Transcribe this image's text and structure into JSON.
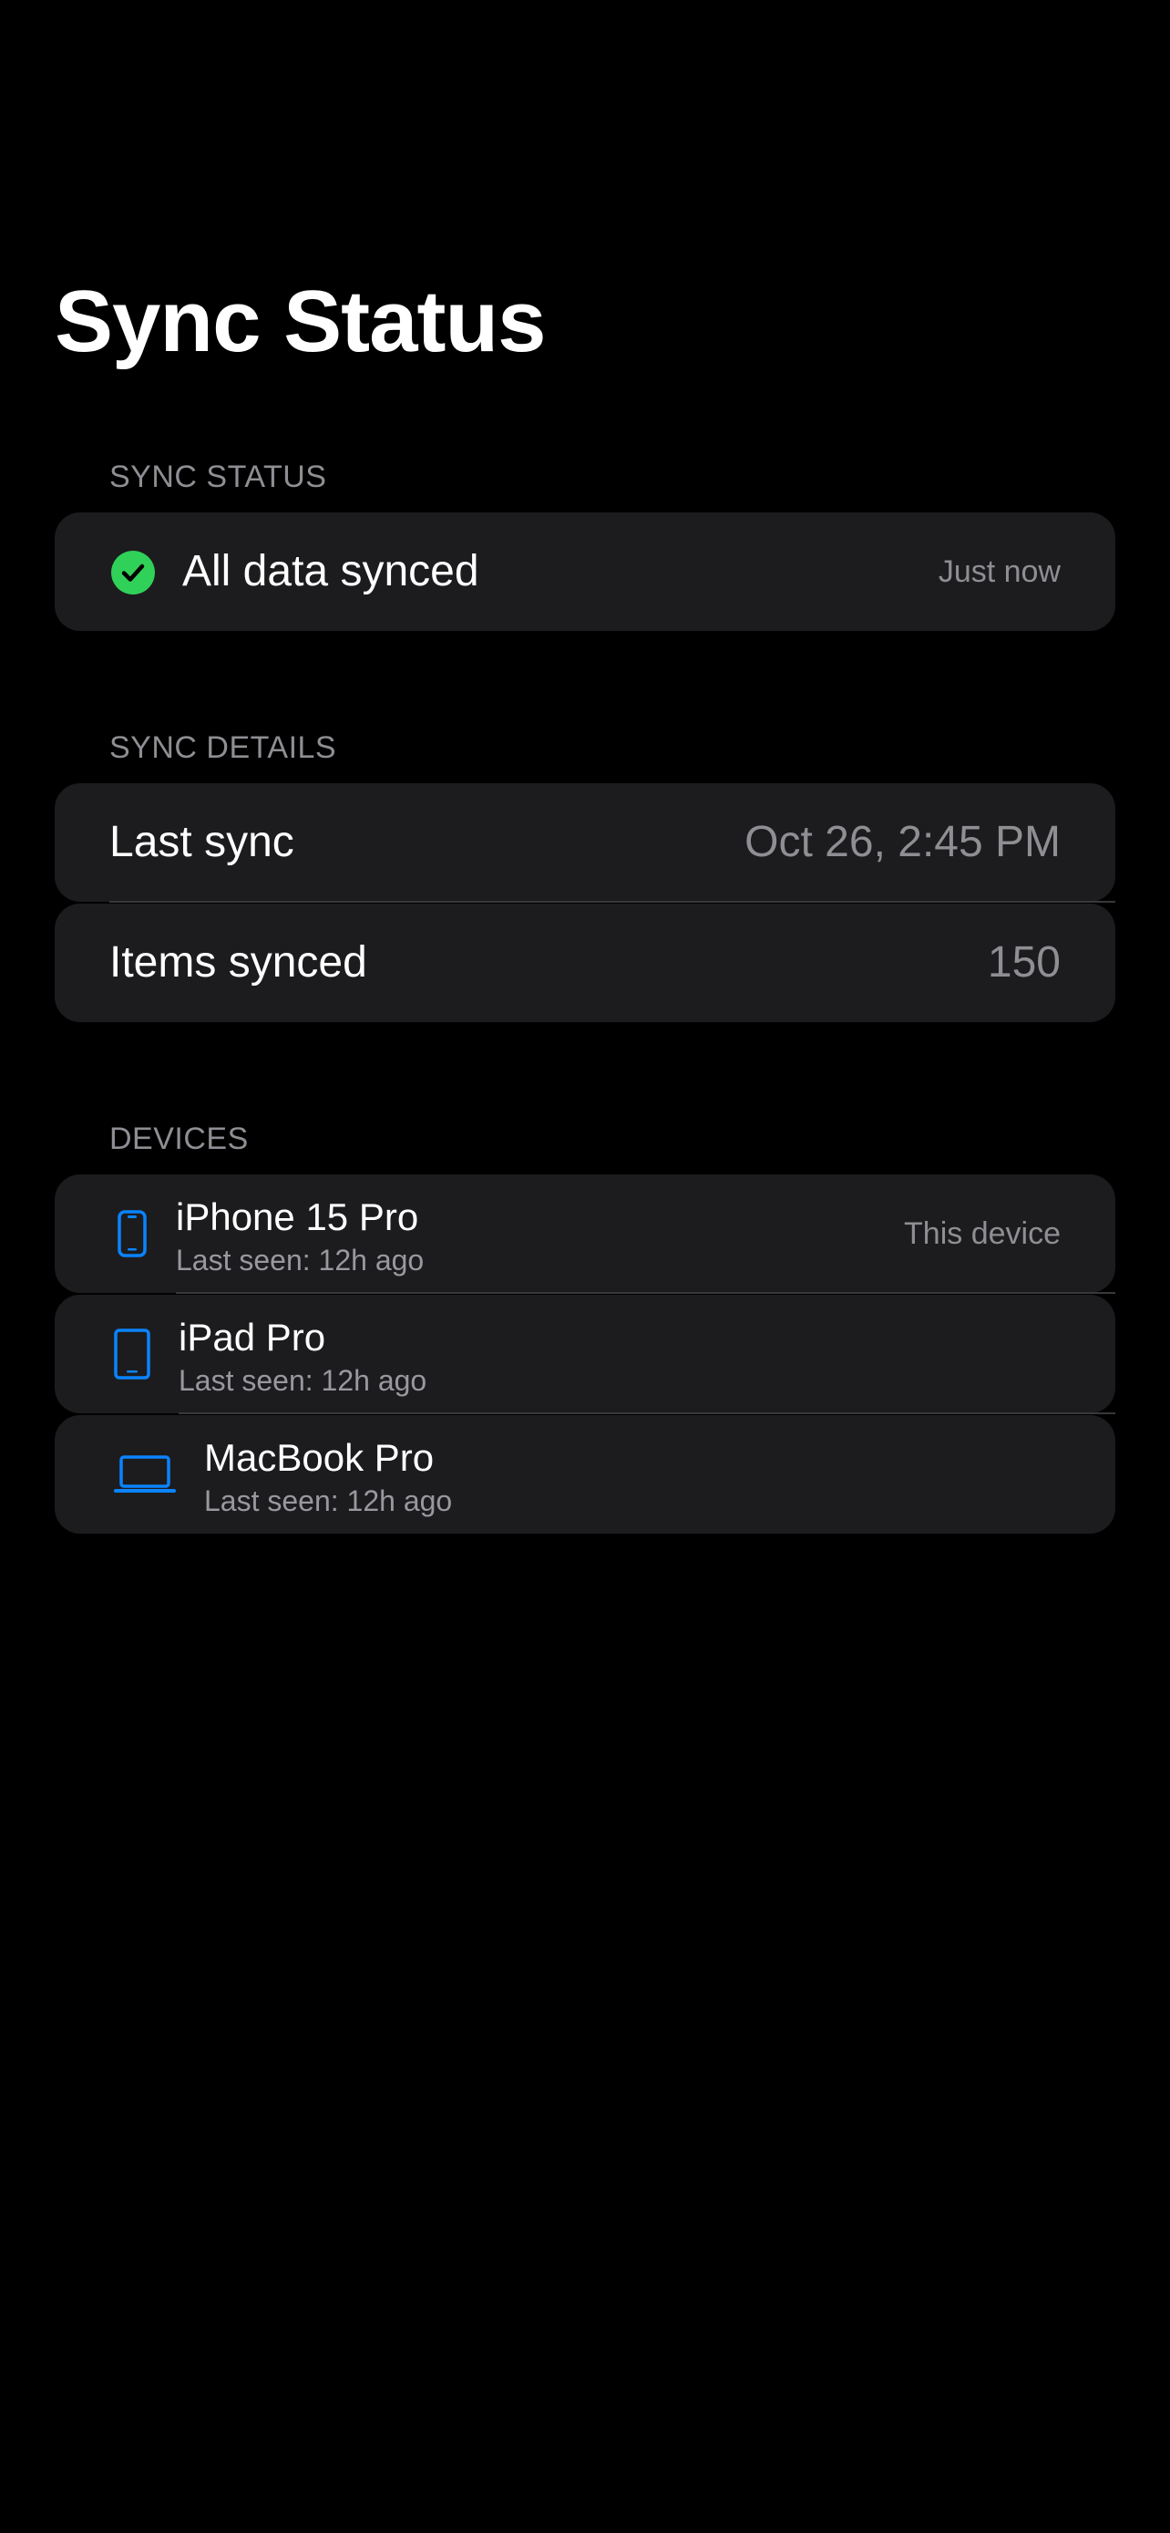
{
  "header": {
    "title": "Sync Status"
  },
  "status_section": {
    "header": "SYNC STATUS",
    "label": "All data synced",
    "time": "Just now",
    "icon": "checkmark-circle-icon",
    "icon_color": "#30d158"
  },
  "details_section": {
    "header": "SYNC DETAILS",
    "rows": [
      {
        "label": "Last sync",
        "value": "Oct 26, 2:45 PM"
      },
      {
        "label": "Items synced",
        "value": "150"
      }
    ]
  },
  "devices_section": {
    "header": "DEVICES",
    "items": [
      {
        "name": "iPhone 15 Pro",
        "last_seen": "Last seen: 12h ago",
        "badge": "This device",
        "icon": "iphone-icon"
      },
      {
        "name": "iPad Pro",
        "last_seen": "Last seen: 12h ago",
        "badge": "",
        "icon": "ipad-icon"
      },
      {
        "name": "MacBook Pro",
        "last_seen": "Last seen: 12h ago",
        "badge": "",
        "icon": "laptop-icon"
      }
    ],
    "icon_color": "#0a84ff"
  },
  "colors": {
    "background": "#000000",
    "card": "#1c1c1e",
    "secondary_text": "#8e8e93",
    "accent": "#0a84ff",
    "success": "#30d158"
  }
}
